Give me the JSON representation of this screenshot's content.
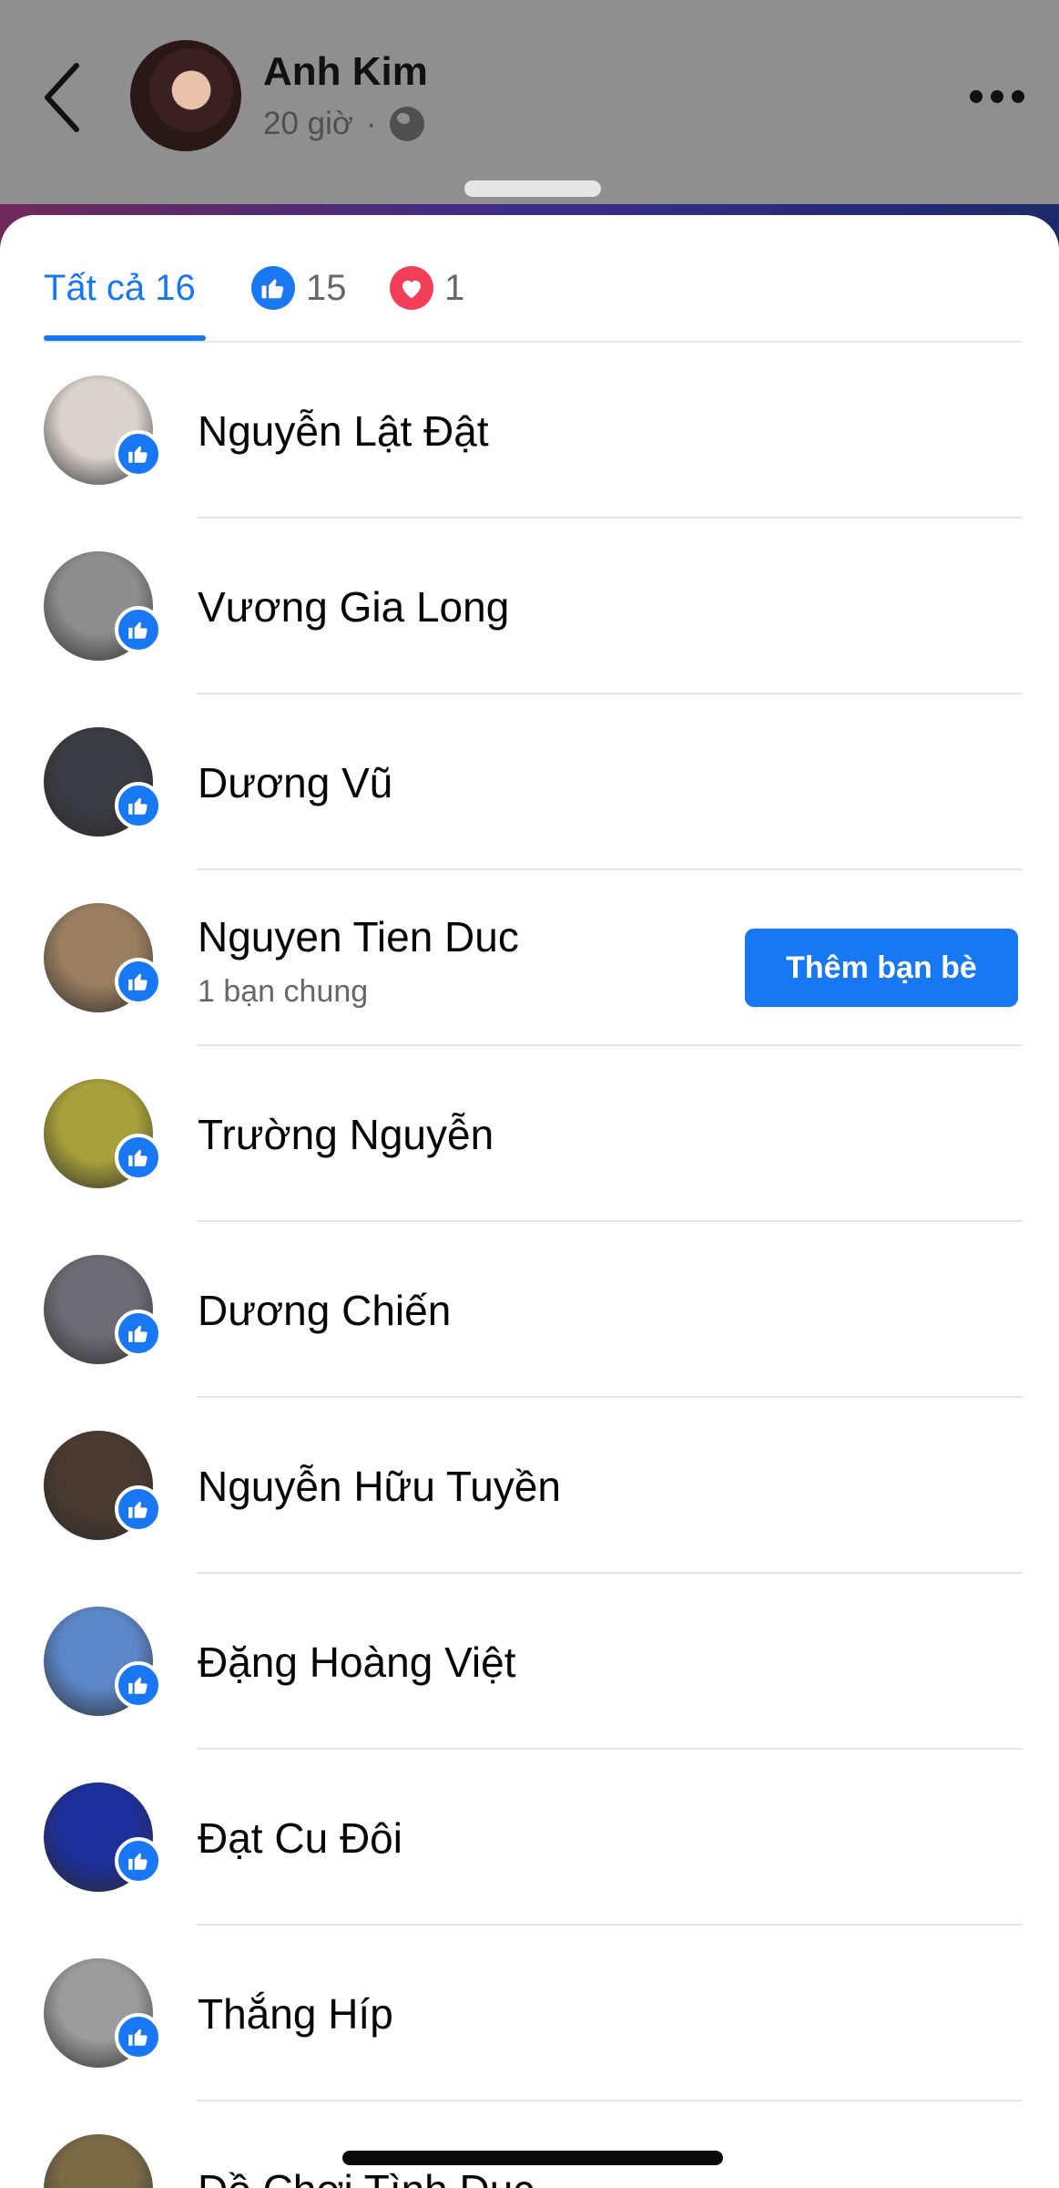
{
  "post": {
    "author": "Anh Kim",
    "time": "20 giờ",
    "separator": "·"
  },
  "tabs": {
    "all_label": "Tất cả 16",
    "like_count": "15",
    "love_count": "1"
  },
  "reactors": [
    {
      "name": "Nguyễn Lật Đật",
      "reaction": "like",
      "avatar_color": "#d9d2cd"
    },
    {
      "name": "Vương Gia Long",
      "reaction": "like",
      "avatar_color": "#8e8e8e"
    },
    {
      "name": "Dương Vũ",
      "reaction": "like",
      "avatar_color": "#3b3b42"
    },
    {
      "name": "Nguyen Tien Duc",
      "subtext": "1 bạn chung",
      "action": "Thêm bạn bè",
      "reaction": "like",
      "avatar_color": "#9a7e5f"
    },
    {
      "name": "Trường Nguyễn",
      "reaction": "like",
      "avatar_color": "#a8a03a"
    },
    {
      "name": "Dương Chiến",
      "reaction": "like",
      "avatar_color": "#6d6c74"
    },
    {
      "name": "Nguyễn Hữu Tuyền",
      "reaction": "like",
      "avatar_color": "#4a3a30"
    },
    {
      "name": "Đặng Hoàng Việt",
      "reaction": "like",
      "avatar_color": "#5b86c7"
    },
    {
      "name": "Đạt Cu Đôi",
      "reaction": "like",
      "avatar_color": "#1d2f9a"
    },
    {
      "name": "Thắng Híp",
      "reaction": "like",
      "avatar_color": "#9c9c9c"
    },
    {
      "name": "Đồ Chơi Tình Dục",
      "reaction": "like",
      "avatar_color": "#7a6a45"
    }
  ],
  "colors": {
    "accent": "#1877f2",
    "love": "#f33e58",
    "dim_overlay": "#8f8f8f"
  }
}
